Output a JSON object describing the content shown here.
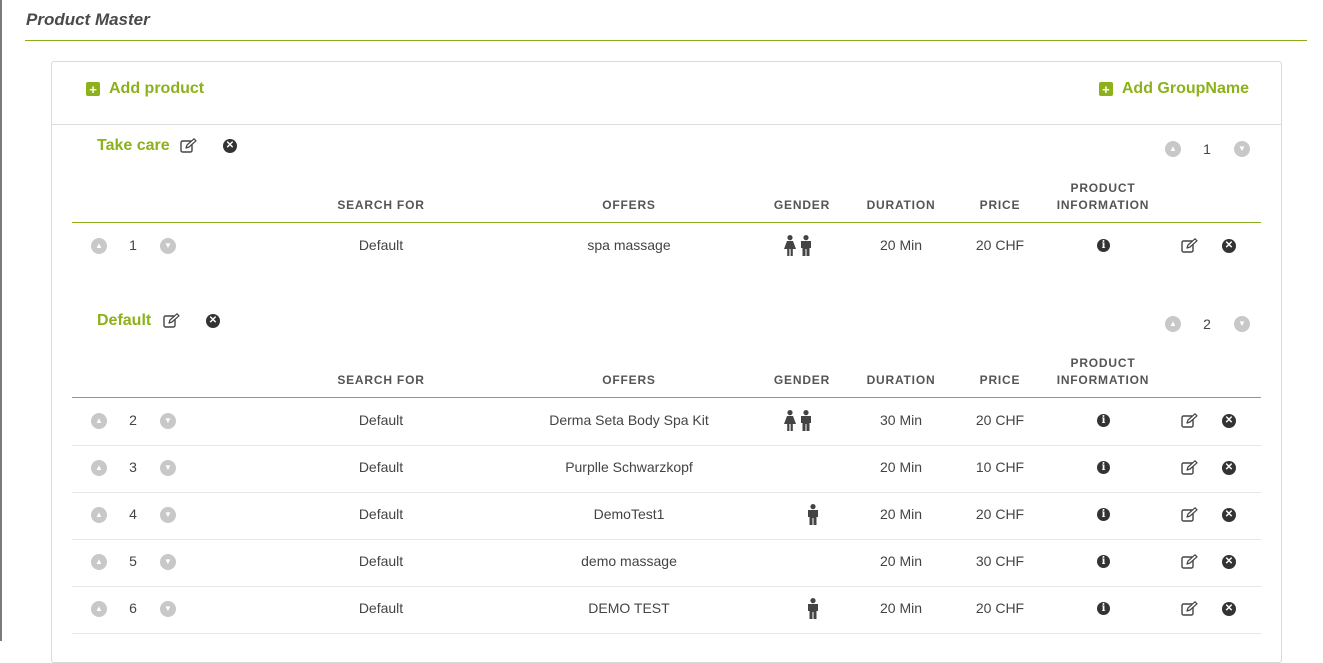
{
  "page": {
    "title": "Product Master"
  },
  "actions": {
    "add_product": "Add product",
    "add_group": "Add GroupName"
  },
  "columns": {
    "search_for": "SEARCH FOR",
    "offers": "OFFERS",
    "gender": "GENDER",
    "duration": "DURATION",
    "price": "PRICE",
    "product_information_1": "PRODUCT",
    "product_information_2": "INFORMATION"
  },
  "icons": {
    "add": "plus-square-icon",
    "edit": "edit-icon",
    "delete": "close-circle-icon",
    "move_up": "chevron-up-circle-icon",
    "move_down": "chevron-down-circle-icon",
    "info": "info-circle-icon",
    "female": "female-icon",
    "male": "male-icon"
  },
  "colors": {
    "accent": "#8cb11b",
    "icon_dark": "#333333",
    "arrow_gray": "#c8c8c8"
  },
  "groups": [
    {
      "name": "Take care",
      "order": "1",
      "rows": [
        {
          "order": "1",
          "search_for": "Default",
          "offer": "spa massage",
          "gender": [
            "female",
            "male"
          ],
          "duration": "20 Min",
          "price": "20 CHF"
        }
      ]
    },
    {
      "name": "Default",
      "order": "2",
      "rows": [
        {
          "order": "2",
          "search_for": "Default",
          "offer": "Derma Seta Body Spa Kit",
          "gender": [
            "female",
            "male"
          ],
          "duration": "30 Min",
          "price": "20 CHF"
        },
        {
          "order": "3",
          "search_for": "Default",
          "offer": "Purplle Schwarzkopf",
          "gender": [],
          "duration": "20 Min",
          "price": "10 CHF"
        },
        {
          "order": "4",
          "search_for": "Default",
          "offer": "DemoTest1",
          "gender": [
            "male"
          ],
          "duration": "20 Min",
          "price": "20 CHF"
        },
        {
          "order": "5",
          "search_for": "Default",
          "offer": "demo massage",
          "gender": [],
          "duration": "20 Min",
          "price": "30 CHF"
        },
        {
          "order": "6",
          "search_for": "Default",
          "offer": "DEMO TEST",
          "gender": [
            "male"
          ],
          "duration": "20 Min",
          "price": "20 CHF"
        }
      ]
    }
  ]
}
